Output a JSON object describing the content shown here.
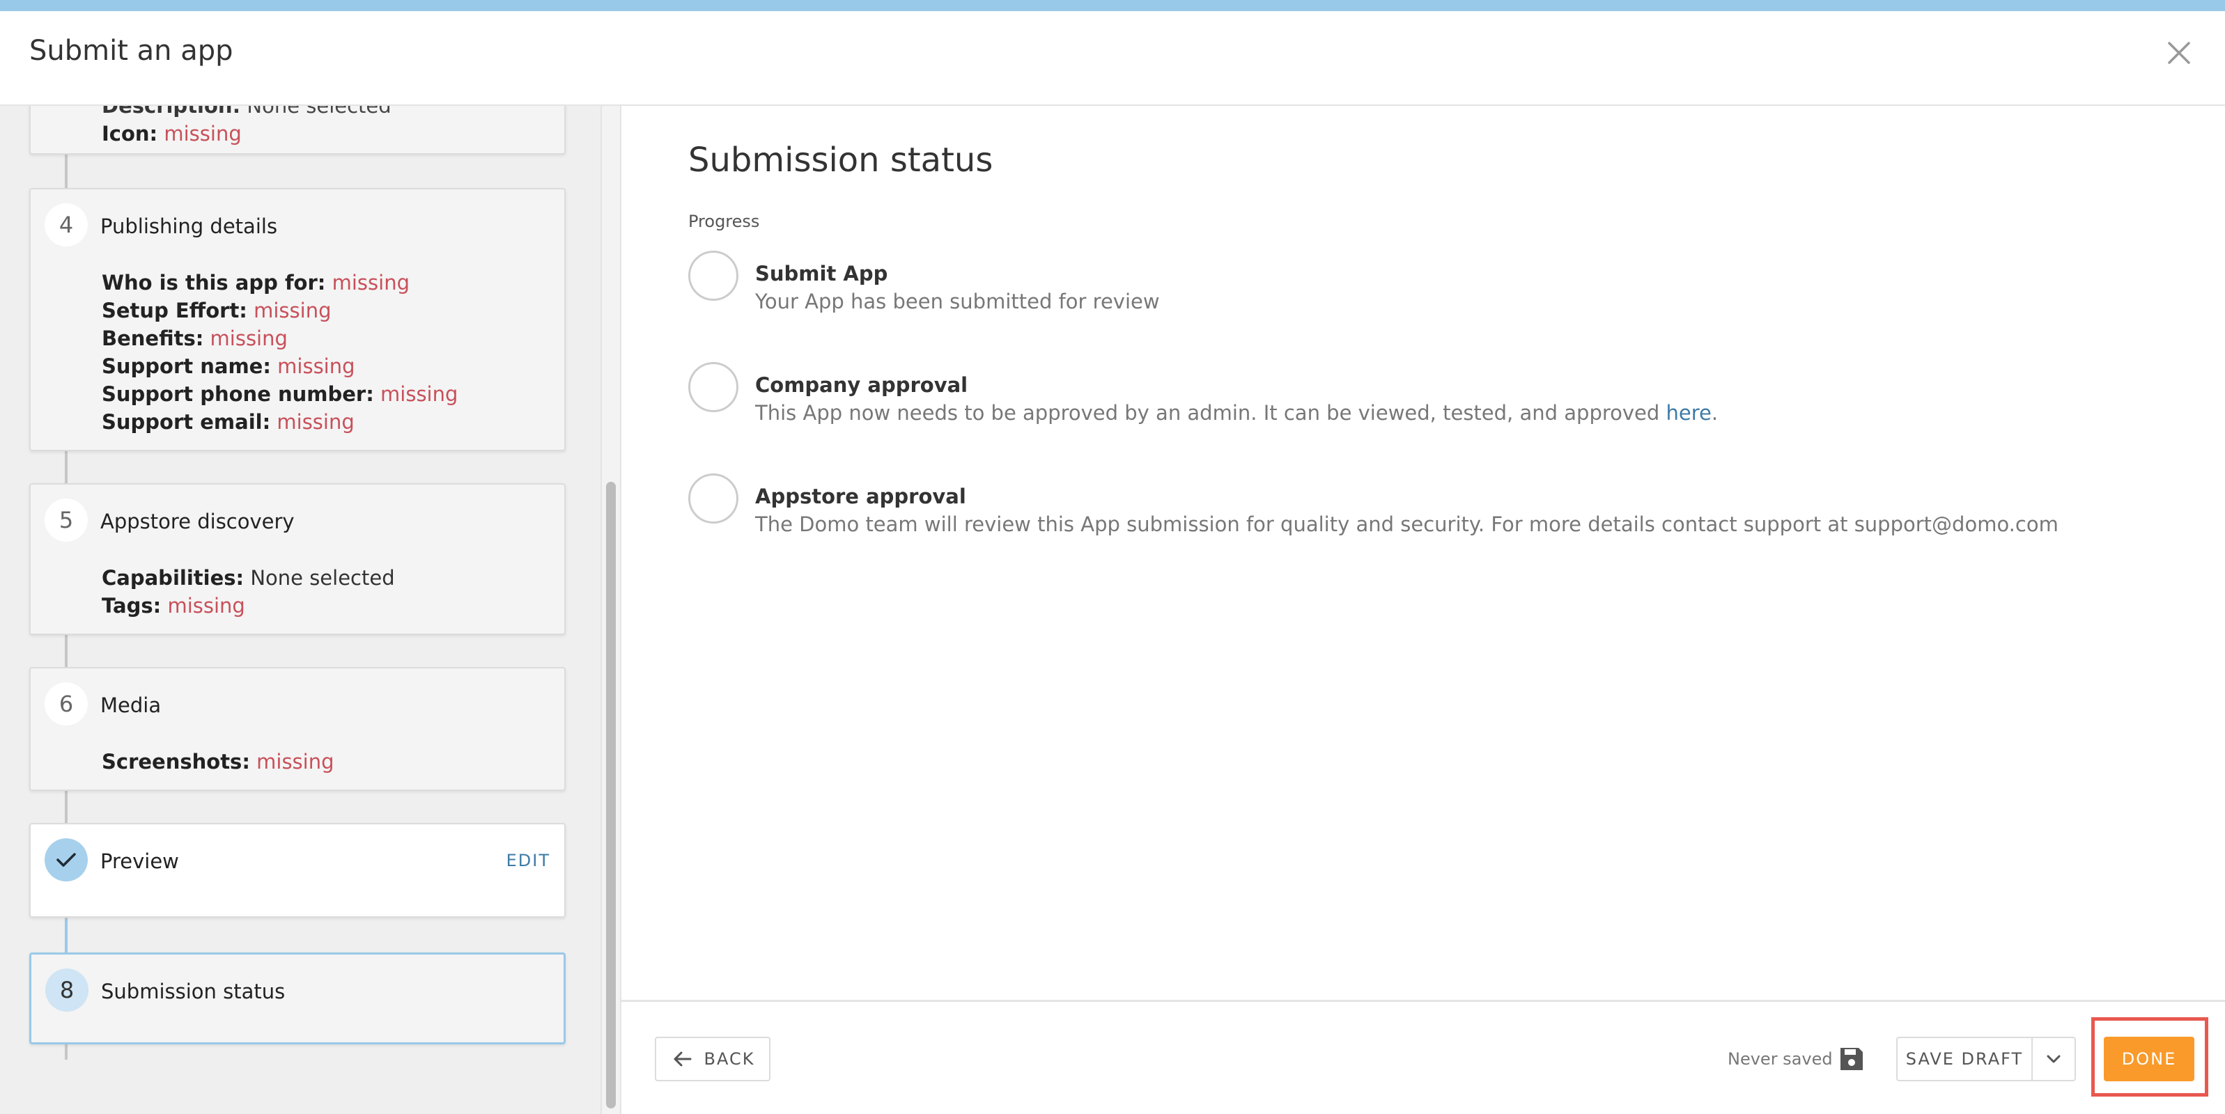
{
  "header": {
    "title": "Submit an app"
  },
  "sidebar": {
    "partial_top": {
      "label": "Description:",
      "value": "None selected",
      "icon_label": "Icon:",
      "icon_value": "missing"
    },
    "steps": [
      {
        "number": "4",
        "title": "Publishing details",
        "fields": [
          {
            "label": "Who is this app for:",
            "value": "missing"
          },
          {
            "label": "Setup Effort:",
            "value": "missing"
          },
          {
            "label": "Benefits:",
            "value": "missing"
          },
          {
            "label": "Support name:",
            "value": "missing"
          },
          {
            "label": "Support phone number:",
            "value": "missing"
          },
          {
            "label": "Support email:",
            "value": "missing"
          }
        ]
      },
      {
        "number": "5",
        "title": "Appstore discovery",
        "fields": [
          {
            "label": "Capabilities:",
            "value": "None selected"
          },
          {
            "label": "Tags:",
            "value": "missing"
          }
        ]
      },
      {
        "number": "6",
        "title": "Media",
        "fields": [
          {
            "label": "Screenshots:",
            "value": "missing"
          }
        ]
      },
      {
        "title": "Preview",
        "edit_label": "EDIT"
      },
      {
        "number": "8",
        "title": "Submission status"
      }
    ]
  },
  "main": {
    "title": "Submission status",
    "progress_label": "Progress",
    "items": [
      {
        "title": "Submit App",
        "desc": "Your App has been submitted for review"
      },
      {
        "title": "Company approval",
        "desc": "This App now needs to be approved by an admin. It can be viewed, tested, and approved ",
        "link": "here",
        "suffix": "."
      },
      {
        "title": "Appstore approval",
        "desc": "The Domo team will review this App submission for quality and security. For more details contact support at support@domo.com"
      }
    ]
  },
  "footer": {
    "back_label": "BACK",
    "never_saved": "Never saved",
    "save_draft_label": "SAVE DRAFT",
    "done_label": "DONE"
  },
  "colors": {
    "accent": "#99c9e8",
    "missing": "#c8505a",
    "done": "#f99a2a",
    "highlight": "#e8584f",
    "link": "#3e7ba6"
  }
}
